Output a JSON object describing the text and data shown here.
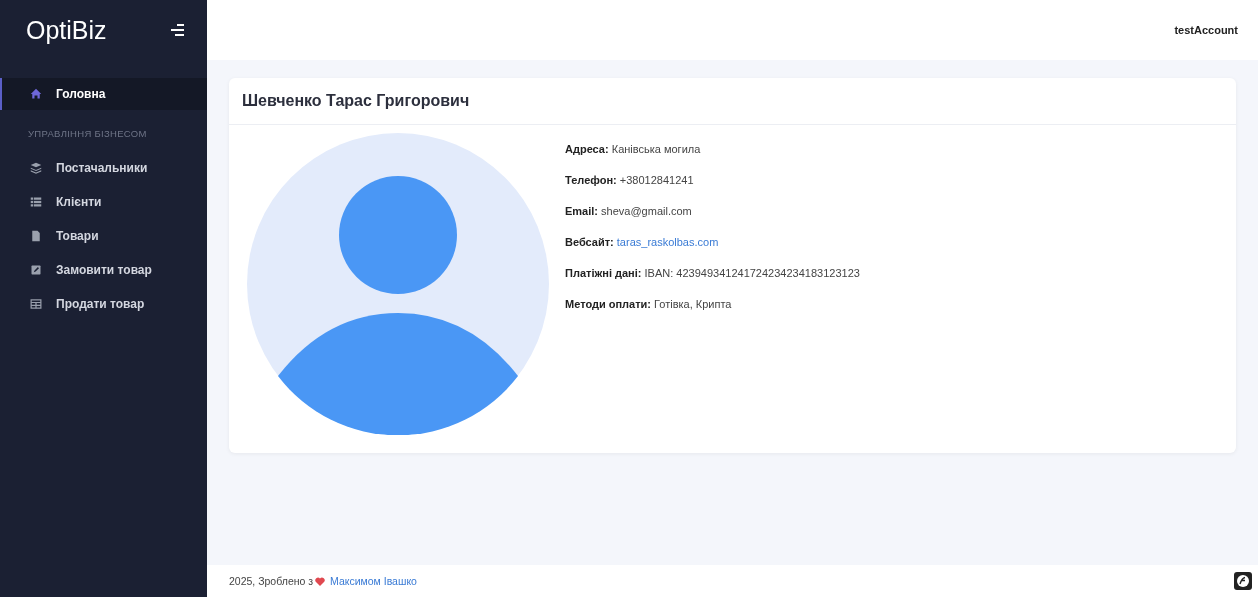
{
  "sidebar": {
    "brand": "OptiBiz",
    "items": [
      {
        "kind": "link",
        "label": "Головна",
        "selected": true
      },
      {
        "kind": "heading",
        "label": "УПРАВЛІННЯ БІЗНЕСОМ"
      },
      {
        "kind": "link",
        "label": "Постачальники",
        "selected": false
      },
      {
        "kind": "link",
        "label": "Клієнти",
        "selected": false
      },
      {
        "kind": "link",
        "label": "Товари",
        "selected": false
      },
      {
        "kind": "link",
        "label": "Замовити товар",
        "selected": false
      },
      {
        "kind": "link",
        "label": "Продати товар",
        "selected": false
      }
    ]
  },
  "header": {
    "account": "testAccount"
  },
  "profile": {
    "name": "Шевченко Тарас Григорович",
    "fields": [
      {
        "kind": "text",
        "label": "Адреса:",
        "value": "Канівська могила"
      },
      {
        "kind": "text",
        "label": "Телефон:",
        "value": "+38012841241"
      },
      {
        "kind": "text",
        "label": "Email:",
        "value": "sheva@gmail.com"
      },
      {
        "kind": "link",
        "label": "Вебсайт:",
        "value": "taras_raskolbas.com"
      },
      {
        "kind": "text",
        "label": "Платіжні дані:",
        "value": "IBAN: 423949341241724234234183123123"
      },
      {
        "kind": "text",
        "label": "Методи оплати:",
        "value": "Готівка, Крипта"
      }
    ]
  },
  "footer": {
    "text": "2025, Зроблено з",
    "author": "Максимом Івашко"
  }
}
